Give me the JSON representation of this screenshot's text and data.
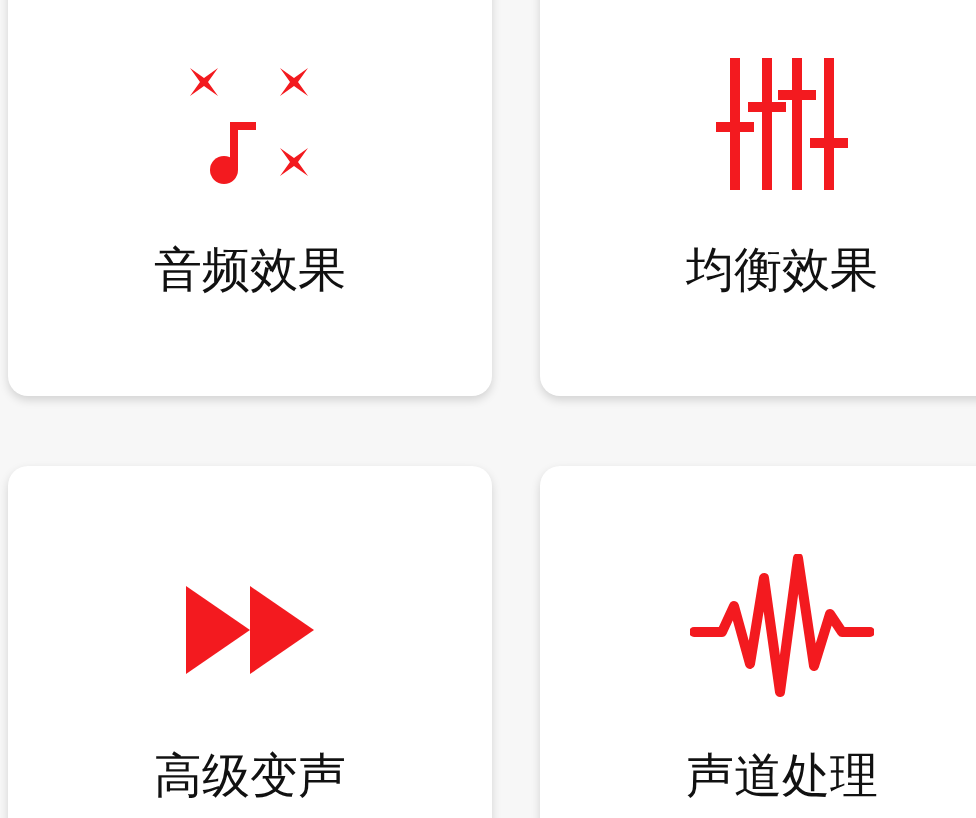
{
  "cards": [
    {
      "label": "音频效果",
      "kind": "music"
    },
    {
      "label": "均衡效果",
      "kind": "equalizer"
    },
    {
      "label": "高级变声",
      "kind": "fast-forward"
    },
    {
      "label": "声道处理",
      "kind": "waveform"
    }
  ]
}
